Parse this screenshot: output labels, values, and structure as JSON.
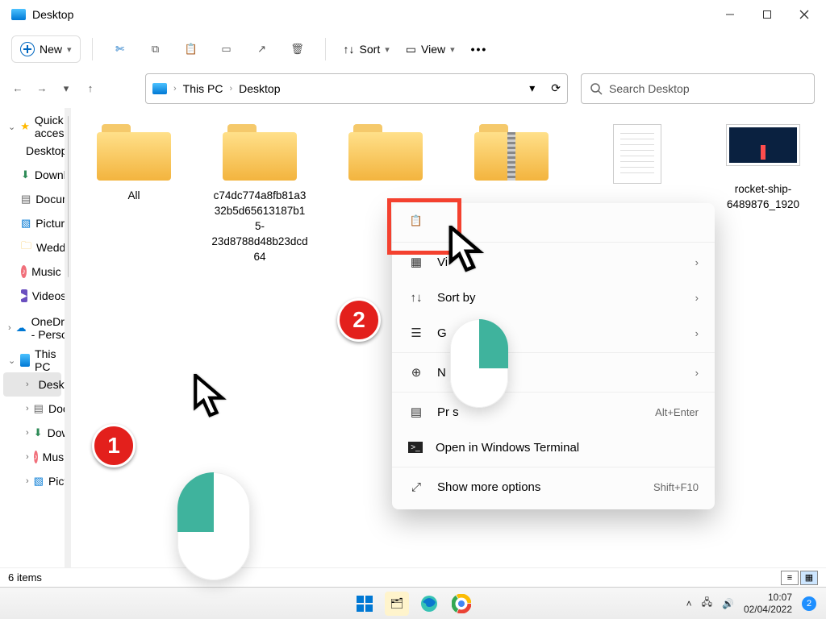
{
  "titlebar": {
    "title": "Desktop"
  },
  "toolbar": {
    "new": "New",
    "sort": "Sort",
    "view": "View"
  },
  "address": {
    "crumbs": [
      "This PC",
      "Desktop"
    ]
  },
  "search": {
    "placeholder": "Search Desktop"
  },
  "sidebar": {
    "quick_access": "Quick access",
    "quick_items": [
      {
        "label": "Desktop"
      },
      {
        "label": "Downloads"
      },
      {
        "label": "Documents"
      },
      {
        "label": "Pictures"
      },
      {
        "label": "Weddings"
      },
      {
        "label": "Music"
      },
      {
        "label": "Videos"
      }
    ],
    "onedrive": "OneDrive - Person",
    "this_pc": "This PC",
    "pc_items": [
      {
        "label": "Desktop"
      },
      {
        "label": "Docu"
      },
      {
        "label": "Downlo"
      },
      {
        "label": "Music"
      },
      {
        "label": "Pictures"
      }
    ]
  },
  "files": {
    "items": [
      {
        "label": "All"
      },
      {
        "label": "c74dc774a8fb81a332b5d65613187b15-23d8788d48b23dcd64"
      },
      {
        "label": ""
      },
      {
        "label": ""
      },
      {
        "label": ""
      },
      {
        "label": "rocket-ship-6489876_1920"
      }
    ]
  },
  "context_menu": {
    "view": "Vi",
    "sort": "Sort by",
    "group": "G",
    "new": "N",
    "properties": "Pr          s",
    "properties_accel": "Alt+Enter",
    "terminal": "Open in Windows Terminal",
    "more": "Show more options",
    "more_accel": "Shift+F10"
  },
  "status": {
    "count": "6 items"
  },
  "taskbar": {
    "time": "10:07",
    "date": "02/04/2022",
    "badge": "2"
  },
  "annotations": {
    "step1": "1",
    "step2": "2"
  }
}
